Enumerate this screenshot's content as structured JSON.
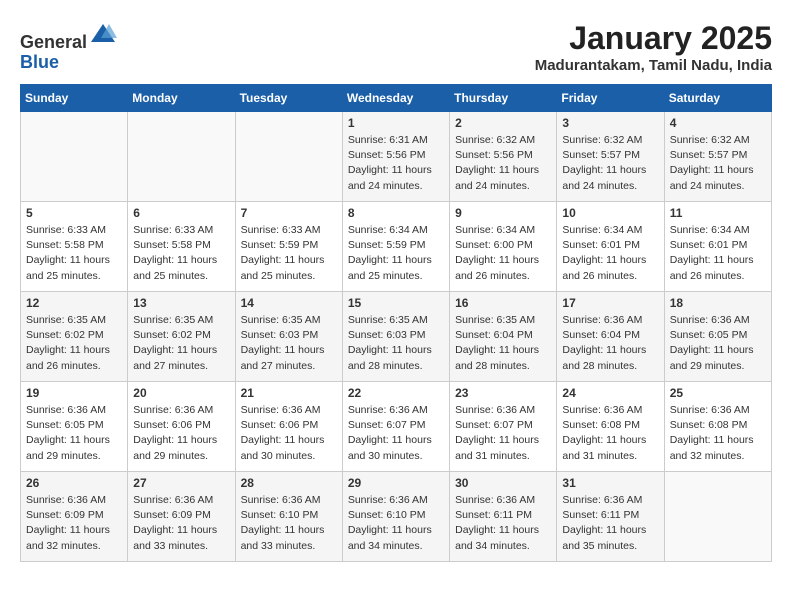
{
  "header": {
    "logo_line1": "General",
    "logo_line2": "Blue",
    "title": "January 2025",
    "subtitle": "Madurantakam, Tamil Nadu, India"
  },
  "weekdays": [
    "Sunday",
    "Monday",
    "Tuesday",
    "Wednesday",
    "Thursday",
    "Friday",
    "Saturday"
  ],
  "weeks": [
    [
      {
        "day": "",
        "info": ""
      },
      {
        "day": "",
        "info": ""
      },
      {
        "day": "",
        "info": ""
      },
      {
        "day": "1",
        "info": "Sunrise: 6:31 AM\nSunset: 5:56 PM\nDaylight: 11 hours\nand 24 minutes."
      },
      {
        "day": "2",
        "info": "Sunrise: 6:32 AM\nSunset: 5:56 PM\nDaylight: 11 hours\nand 24 minutes."
      },
      {
        "day": "3",
        "info": "Sunrise: 6:32 AM\nSunset: 5:57 PM\nDaylight: 11 hours\nand 24 minutes."
      },
      {
        "day": "4",
        "info": "Sunrise: 6:32 AM\nSunset: 5:57 PM\nDaylight: 11 hours\nand 24 minutes."
      }
    ],
    [
      {
        "day": "5",
        "info": "Sunrise: 6:33 AM\nSunset: 5:58 PM\nDaylight: 11 hours\nand 25 minutes."
      },
      {
        "day": "6",
        "info": "Sunrise: 6:33 AM\nSunset: 5:58 PM\nDaylight: 11 hours\nand 25 minutes."
      },
      {
        "day": "7",
        "info": "Sunrise: 6:33 AM\nSunset: 5:59 PM\nDaylight: 11 hours\nand 25 minutes."
      },
      {
        "day": "8",
        "info": "Sunrise: 6:34 AM\nSunset: 5:59 PM\nDaylight: 11 hours\nand 25 minutes."
      },
      {
        "day": "9",
        "info": "Sunrise: 6:34 AM\nSunset: 6:00 PM\nDaylight: 11 hours\nand 26 minutes."
      },
      {
        "day": "10",
        "info": "Sunrise: 6:34 AM\nSunset: 6:01 PM\nDaylight: 11 hours\nand 26 minutes."
      },
      {
        "day": "11",
        "info": "Sunrise: 6:34 AM\nSunset: 6:01 PM\nDaylight: 11 hours\nand 26 minutes."
      }
    ],
    [
      {
        "day": "12",
        "info": "Sunrise: 6:35 AM\nSunset: 6:02 PM\nDaylight: 11 hours\nand 26 minutes."
      },
      {
        "day": "13",
        "info": "Sunrise: 6:35 AM\nSunset: 6:02 PM\nDaylight: 11 hours\nand 27 minutes."
      },
      {
        "day": "14",
        "info": "Sunrise: 6:35 AM\nSunset: 6:03 PM\nDaylight: 11 hours\nand 27 minutes."
      },
      {
        "day": "15",
        "info": "Sunrise: 6:35 AM\nSunset: 6:03 PM\nDaylight: 11 hours\nand 28 minutes."
      },
      {
        "day": "16",
        "info": "Sunrise: 6:35 AM\nSunset: 6:04 PM\nDaylight: 11 hours\nand 28 minutes."
      },
      {
        "day": "17",
        "info": "Sunrise: 6:36 AM\nSunset: 6:04 PM\nDaylight: 11 hours\nand 28 minutes."
      },
      {
        "day": "18",
        "info": "Sunrise: 6:36 AM\nSunset: 6:05 PM\nDaylight: 11 hours\nand 29 minutes."
      }
    ],
    [
      {
        "day": "19",
        "info": "Sunrise: 6:36 AM\nSunset: 6:05 PM\nDaylight: 11 hours\nand 29 minutes."
      },
      {
        "day": "20",
        "info": "Sunrise: 6:36 AM\nSunset: 6:06 PM\nDaylight: 11 hours\nand 29 minutes."
      },
      {
        "day": "21",
        "info": "Sunrise: 6:36 AM\nSunset: 6:06 PM\nDaylight: 11 hours\nand 30 minutes."
      },
      {
        "day": "22",
        "info": "Sunrise: 6:36 AM\nSunset: 6:07 PM\nDaylight: 11 hours\nand 30 minutes."
      },
      {
        "day": "23",
        "info": "Sunrise: 6:36 AM\nSunset: 6:07 PM\nDaylight: 11 hours\nand 31 minutes."
      },
      {
        "day": "24",
        "info": "Sunrise: 6:36 AM\nSunset: 6:08 PM\nDaylight: 11 hours\nand 31 minutes."
      },
      {
        "day": "25",
        "info": "Sunrise: 6:36 AM\nSunset: 6:08 PM\nDaylight: 11 hours\nand 32 minutes."
      }
    ],
    [
      {
        "day": "26",
        "info": "Sunrise: 6:36 AM\nSunset: 6:09 PM\nDaylight: 11 hours\nand 32 minutes."
      },
      {
        "day": "27",
        "info": "Sunrise: 6:36 AM\nSunset: 6:09 PM\nDaylight: 11 hours\nand 33 minutes."
      },
      {
        "day": "28",
        "info": "Sunrise: 6:36 AM\nSunset: 6:10 PM\nDaylight: 11 hours\nand 33 minutes."
      },
      {
        "day": "29",
        "info": "Sunrise: 6:36 AM\nSunset: 6:10 PM\nDaylight: 11 hours\nand 34 minutes."
      },
      {
        "day": "30",
        "info": "Sunrise: 6:36 AM\nSunset: 6:11 PM\nDaylight: 11 hours\nand 34 minutes."
      },
      {
        "day": "31",
        "info": "Sunrise: 6:36 AM\nSunset: 6:11 PM\nDaylight: 11 hours\nand 35 minutes."
      },
      {
        "day": "",
        "info": ""
      }
    ]
  ]
}
